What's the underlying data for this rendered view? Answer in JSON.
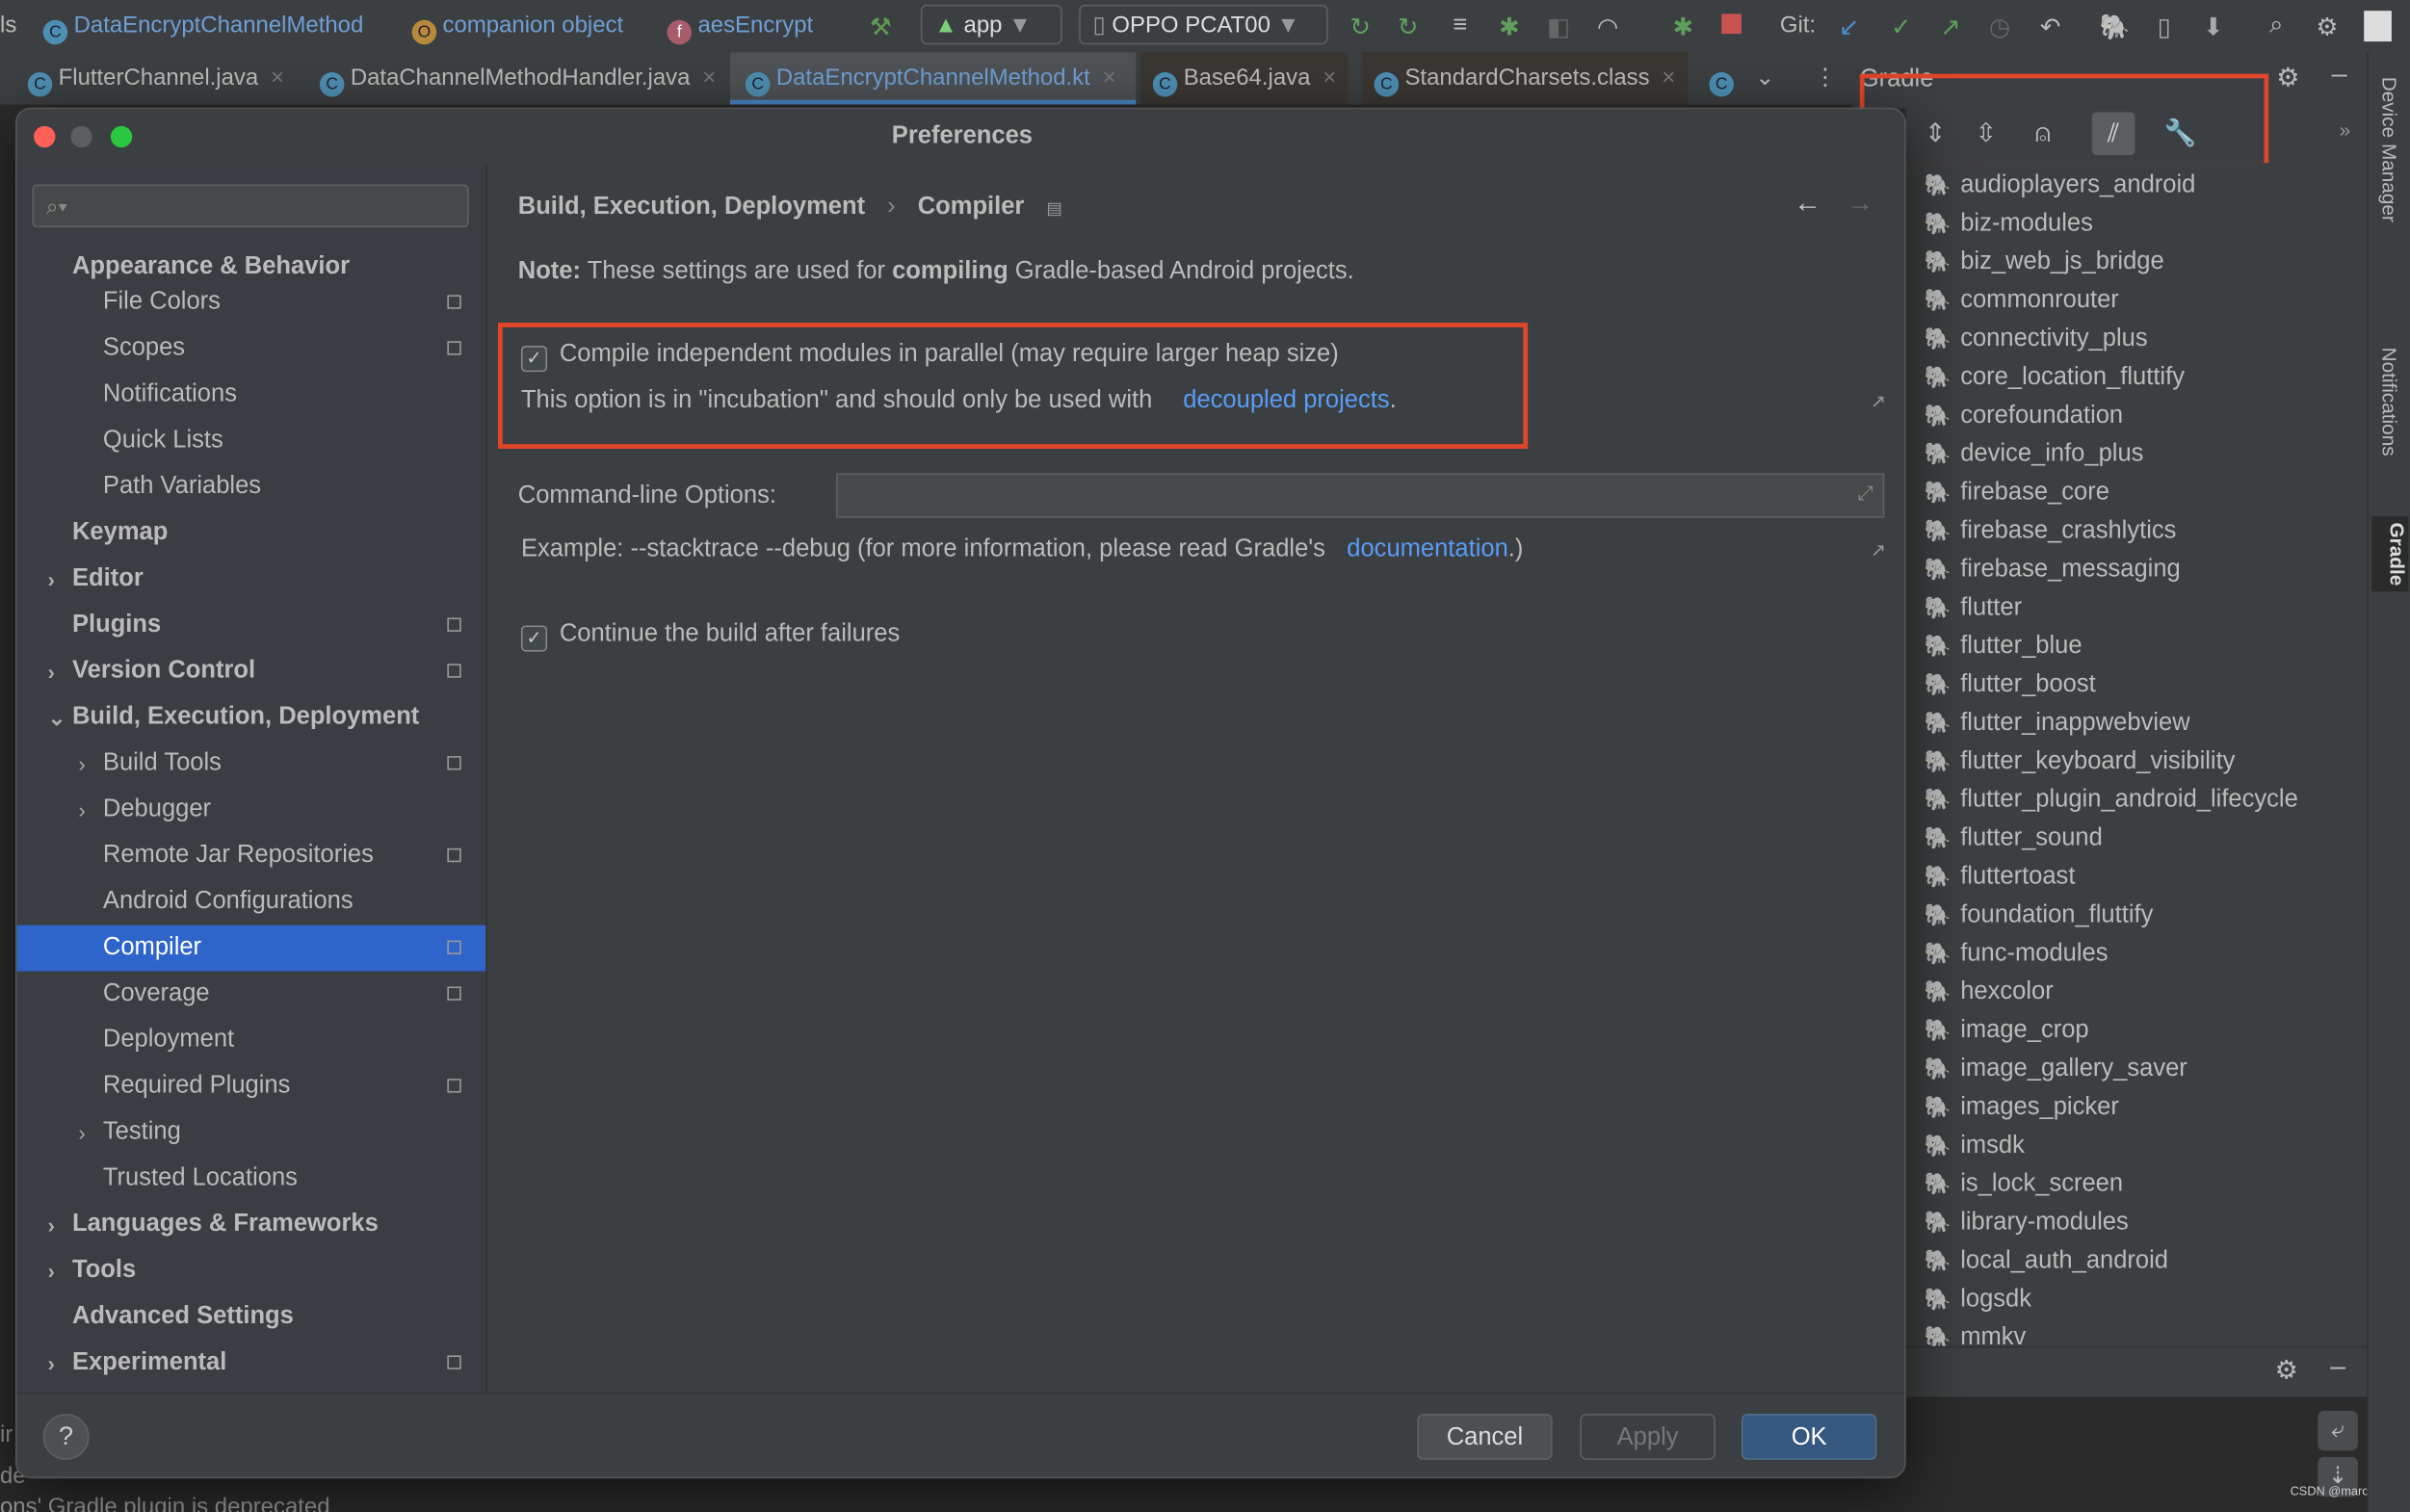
{
  "navbar": {
    "crumb_prefix": "ls",
    "crumbs": [
      "DataEncryptChannelMethod",
      "companion object",
      "aesEncrypt"
    ],
    "run_config": "app",
    "device": "OPPO PCAT00",
    "git_label": "Git:"
  },
  "editor_tabs": [
    {
      "label": "FlutterChannel.java",
      "active": false
    },
    {
      "label": "DataChannelMethodHandler.java",
      "active": false
    },
    {
      "label": "DataEncryptChannelMethod.kt",
      "active": true
    },
    {
      "label": "Base64.java",
      "active": false
    },
    {
      "label": "StandardCharsets.class",
      "active": false
    }
  ],
  "gradle": {
    "title": "Gradle",
    "projects": [
      "audioplayers_android",
      "biz-modules",
      "biz_web_js_bridge",
      "commonrouter",
      "connectivity_plus",
      "core_location_fluttify",
      "corefoundation",
      "device_info_plus",
      "firebase_core",
      "firebase_crashlytics",
      "firebase_messaging",
      "flutter",
      "flutter_blue",
      "flutter_boost",
      "flutter_inappwebview",
      "flutter_keyboard_visibility",
      "flutter_plugin_android_lifecycle",
      "flutter_sound",
      "fluttertoast",
      "foundation_fluttify",
      "func-modules",
      "hexcolor",
      "image_crop",
      "image_gallery_saver",
      "images_picker",
      "imsdk",
      "is_lock_screen",
      "library-modules",
      "local_auth_android",
      "logsdk",
      "mmkv"
    ]
  },
  "right_strip": [
    "Device Manager",
    "Notifications",
    "Gradle"
  ],
  "background_text": [
    "ir",
    "de",
    "ons' Gradle plugin is deprecated"
  ],
  "dialog": {
    "title": "Preferences",
    "search_placeholder": "",
    "tree": [
      {
        "label": "Appearance & Behavior",
        "level": 0,
        "bold": true,
        "arrow": "",
        "pm": false
      },
      {
        "label": "File Colors",
        "level": 1,
        "bold": false,
        "arrow": "",
        "pm": true
      },
      {
        "label": "Scopes",
        "level": 1,
        "bold": false,
        "arrow": "",
        "pm": true
      },
      {
        "label": "Notifications",
        "level": 1,
        "bold": false,
        "arrow": "",
        "pm": false
      },
      {
        "label": "Quick Lists",
        "level": 1,
        "bold": false,
        "arrow": "",
        "pm": false
      },
      {
        "label": "Path Variables",
        "level": 1,
        "bold": false,
        "arrow": "",
        "pm": false
      },
      {
        "label": "Keymap",
        "level": 0,
        "bold": true,
        "arrow": "",
        "pm": false
      },
      {
        "label": "Editor",
        "level": 0,
        "bold": true,
        "arrow": "collapsed",
        "pm": false
      },
      {
        "label": "Plugins",
        "level": 0,
        "bold": true,
        "arrow": "",
        "pm": true
      },
      {
        "label": "Version Control",
        "level": 0,
        "bold": true,
        "arrow": "collapsed",
        "pm": true
      },
      {
        "label": "Build, Execution, Deployment",
        "level": 0,
        "bold": true,
        "arrow": "expanded",
        "pm": false
      },
      {
        "label": "Build Tools",
        "level": 1,
        "bold": false,
        "arrow": "collapsed",
        "pm": true
      },
      {
        "label": "Debugger",
        "level": 1,
        "bold": false,
        "arrow": "collapsed",
        "pm": false
      },
      {
        "label": "Remote Jar Repositories",
        "level": 1,
        "bold": false,
        "arrow": "",
        "pm": true
      },
      {
        "label": "Android Configurations",
        "level": 1,
        "bold": false,
        "arrow": "",
        "pm": false
      },
      {
        "label": "Compiler",
        "level": 1,
        "bold": false,
        "arrow": "",
        "pm": true,
        "selected": true
      },
      {
        "label": "Coverage",
        "level": 1,
        "bold": false,
        "arrow": "",
        "pm": true
      },
      {
        "label": "Deployment",
        "level": 1,
        "bold": false,
        "arrow": "",
        "pm": false
      },
      {
        "label": "Required Plugins",
        "level": 1,
        "bold": false,
        "arrow": "",
        "pm": true
      },
      {
        "label": "Testing",
        "level": 1,
        "bold": false,
        "arrow": "collapsed",
        "pm": false
      },
      {
        "label": "Trusted Locations",
        "level": 1,
        "bold": false,
        "arrow": "",
        "pm": false
      },
      {
        "label": "Languages & Frameworks",
        "level": 0,
        "bold": true,
        "arrow": "collapsed",
        "pm": false
      },
      {
        "label": "Tools",
        "level": 0,
        "bold": true,
        "arrow": "collapsed",
        "pm": false
      },
      {
        "label": "Advanced Settings",
        "level": 0,
        "bold": true,
        "arrow": "",
        "pm": false
      },
      {
        "label": "Experimental",
        "level": 0,
        "bold": true,
        "arrow": "collapsed",
        "pm": true
      }
    ],
    "breadcrumb": {
      "parent": "Build, Execution, Deployment",
      "current": "Compiler"
    },
    "note": {
      "label": "Note:",
      "pre": " These settings are used for ",
      "bold": "compiling",
      "post": " Gradle-based Android projects."
    },
    "parallel": {
      "checked": true,
      "label": "Compile independent modules in parallel (may require larger heap size)",
      "hint": "This option is in \"incubation\" and should only be used with",
      "link": "decoupled projects",
      "link_suffix": "."
    },
    "cmd_label": "Command-line Options:",
    "cmd_value": "",
    "example": {
      "text": "Example: --stacktrace --debug (for more information, please read Gradle's",
      "link": "documentation",
      "suffix": ".)"
    },
    "continue": {
      "checked": true,
      "label": "Continue the build after failures"
    },
    "buttons": {
      "cancel": "Cancel",
      "apply": "Apply",
      "ok": "OK",
      "help": "?"
    }
  },
  "watermark": "CSDN @marchlqq",
  "colors": {
    "accent": "#2f65ca",
    "link": "#589df6",
    "highlight_box": "#e0462a",
    "ok_button": "#365880"
  }
}
